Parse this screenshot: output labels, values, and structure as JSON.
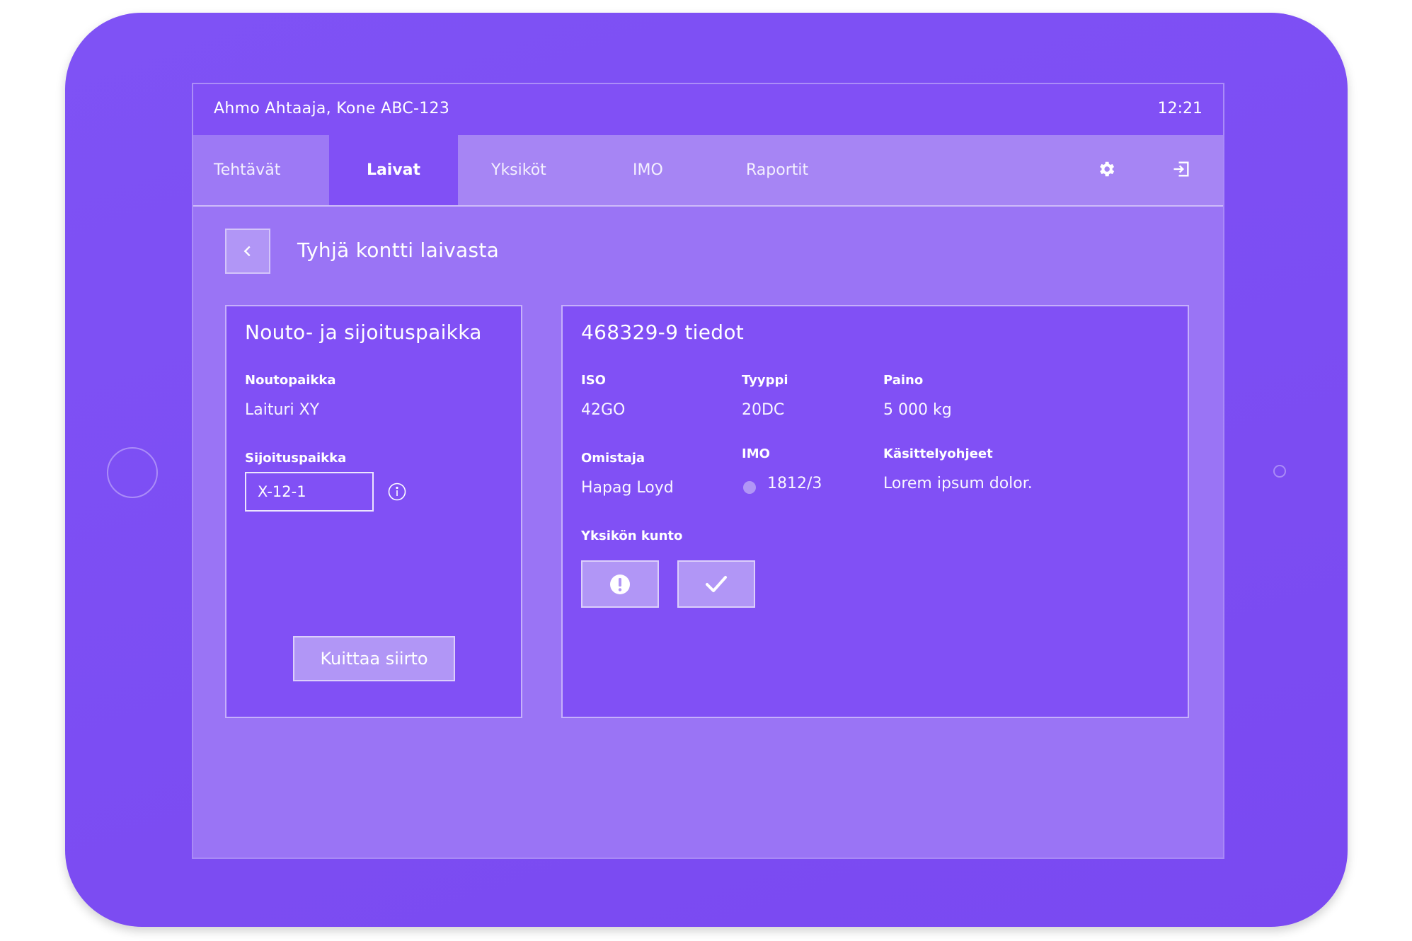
{
  "header": {
    "user": "Ahmo Ahtaaja, Kone ABC-123",
    "time": "12:21"
  },
  "nav": {
    "tabs": [
      {
        "label": "Tehtävät"
      },
      {
        "label": "Laivat",
        "active": true
      },
      {
        "label": "Yksiköt"
      },
      {
        "label": "IMO"
      },
      {
        "label": "Raportit"
      }
    ],
    "icons": [
      "gear-icon",
      "logout-icon"
    ]
  },
  "page": {
    "title": "Tyhjä kontti laivasta",
    "back_icon": "chevron-left-icon"
  },
  "location": {
    "title": "Nouto- ja sijoituspaikka",
    "pickup_label": "Noutopaikka",
    "pickup_value": "Laituri XY",
    "placement_label": "Sijoituspaikka",
    "placement_value": "X-12-1",
    "info_icon": "info-icon",
    "confirm_label": "Kuittaa siirto"
  },
  "details": {
    "title": "468329-9 tiedot",
    "iso_label": "ISO",
    "iso_value": "42GO",
    "type_label": "Tyyppi",
    "type_value": "20DC",
    "weight_label": "Paino",
    "weight_value": "5 000 kg",
    "owner_label": "Omistaja",
    "owner_value": "Hapag Loyd",
    "imo_label": "IMO",
    "imo_value": "1812/3",
    "handling_label": "Käsittelyohjeet",
    "handling_value": "Lorem ipsum dolor.",
    "condition_label": "Yksikön kunto",
    "condition_icons": [
      "alert-icon",
      "check-icon"
    ]
  },
  "colors": {
    "device": "#7f52f5",
    "screen": "#9a74f5",
    "card": "#8150f5",
    "button": "#b196f6"
  }
}
